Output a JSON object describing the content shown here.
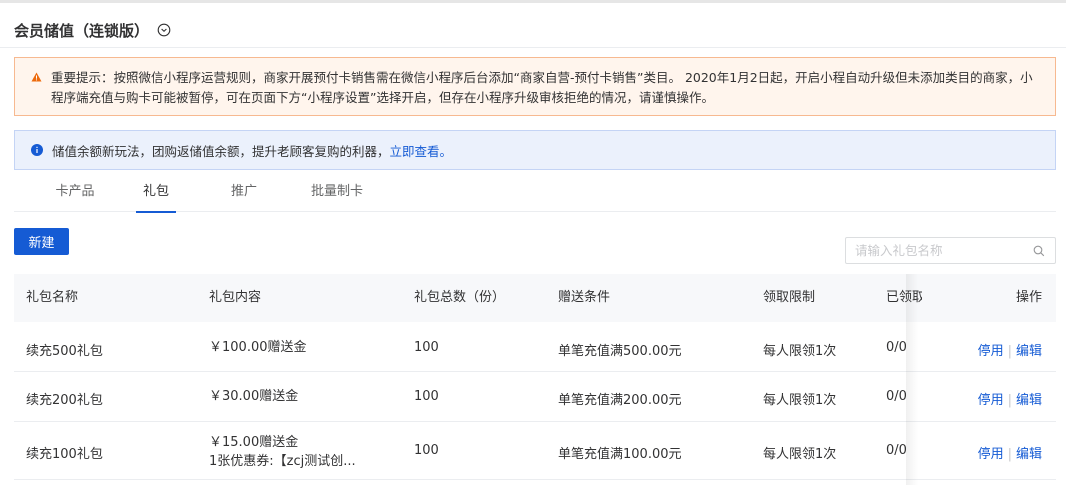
{
  "page": {
    "title": "会员储值（连锁版）",
    "title_icon": "chevron-down-circle-icon"
  },
  "warning": {
    "icon": "warning-triangle-icon",
    "color": "#ed6a0c",
    "text": "重要提示：按照微信小程序运营规则，商家开展预付卡销售需在微信小程序后台添加“商家自营-预付卡销售”类目。 2020年1月2日起，开启小程自动升级但未添加类目的商家，小程序端充值与购卡可能被暂停，可在页面下方“小程序设置”选择开启，但存在小程序升级审核拒绝的情况，请谨慎操作。"
  },
  "info": {
    "icon": "info-circle-icon",
    "text": "储值余额新玩法，团购返储值余额，提升老顾客复购的利器，",
    "link": "立即查看。"
  },
  "tabs": [
    {
      "label": "卡产品",
      "active": false
    },
    {
      "label": "礼包",
      "active": true
    },
    {
      "label": "推广",
      "active": false
    },
    {
      "label": "批量制卡",
      "active": false
    }
  ],
  "toolbar": {
    "new_label": "新建",
    "search_placeholder": "请输入礼包名称",
    "search_icon": "search-icon"
  },
  "table": {
    "headers": [
      "礼包名称",
      "礼包内容",
      "礼包总数（份）",
      "赠送条件",
      "领取限制",
      "已领取",
      "操作"
    ],
    "rows": [
      {
        "name": "续充500礼包",
        "content": [
          "￥100.00赠送金"
        ],
        "total": "100",
        "condition": "单笔充值满500.00元",
        "limit": "每人限领1次",
        "received": "0/0",
        "ops": [
          "停用",
          "编辑"
        ]
      },
      {
        "name": "续充200礼包",
        "content": [
          "￥30.00赠送金"
        ],
        "total": "100",
        "condition": "单笔充值满200.00元",
        "limit": "每人限领1次",
        "received": "0/0",
        "ops": [
          "停用",
          "编辑"
        ]
      },
      {
        "name": "续充100礼包",
        "content": [
          "￥15.00赠送金",
          "1张优惠券:【zcj测试创..."
        ],
        "total": "100",
        "condition": "单笔充值满100.00元",
        "limit": "每人限领1次",
        "received": "0/0",
        "ops": [
          "停用",
          "编辑"
        ]
      }
    ]
  },
  "colors": {
    "primary": "#155bd4",
    "warning_bg": "#fff5ed",
    "info_bg": "#ebf1fc"
  }
}
